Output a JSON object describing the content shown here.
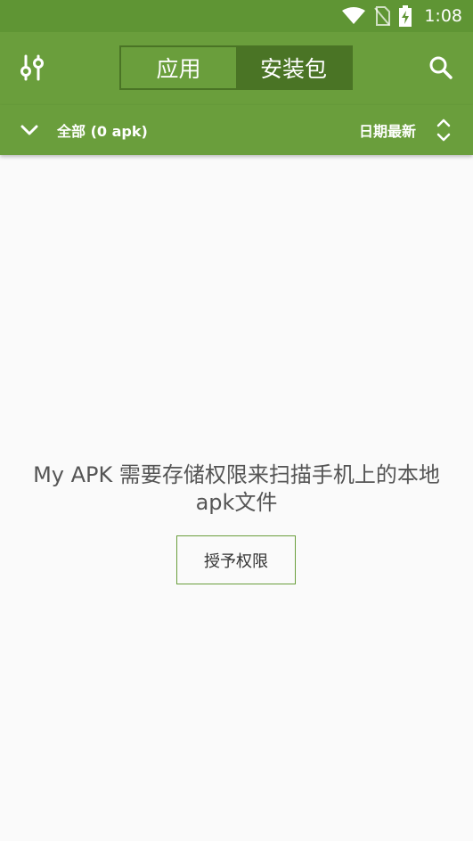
{
  "status_bar": {
    "time": "1:08"
  },
  "toolbar": {
    "tabs": [
      {
        "label": "应用",
        "active": false
      },
      {
        "label": "安装包",
        "active": true
      }
    ]
  },
  "subbar": {
    "filter_label": "全部 (0 apk)",
    "sort_label": "日期最新"
  },
  "content": {
    "message": "My APK 需要存储权限来扫描手机上的本地apk文件",
    "grant_button": "授予权限"
  },
  "colors": {
    "primary": "#6a9e3c",
    "primary_dark": "#4a7425",
    "status_bar": "#5f9534",
    "background": "#fafafa"
  }
}
